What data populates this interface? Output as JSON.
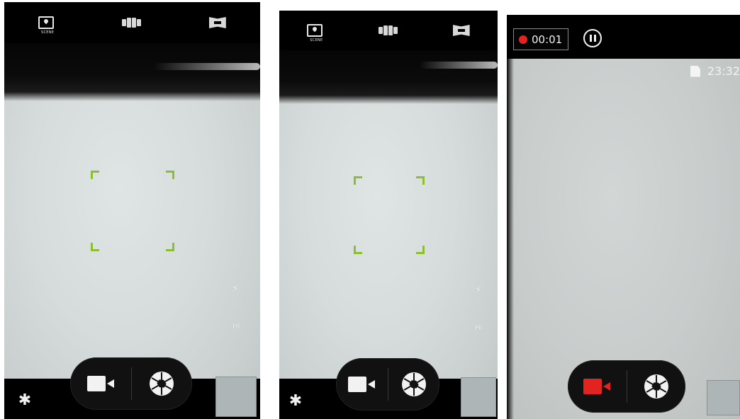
{
  "colors": {
    "focus_bracket": "#8cbf2f",
    "record_red": "#e3231f",
    "panel_black": "#000000"
  },
  "screens": [
    {
      "state": "photo",
      "mode_bar": {
        "scene_label": "SCENE",
        "scene_icon": "scene-icon",
        "multi_icon": "multi-shot-icon",
        "panorama_icon": "panorama-icon"
      },
      "controls": {
        "video_icon": "video-camera-icon",
        "shutter_icon": "shutter-icon",
        "settings_icon": "gear-icon",
        "settings_glyph": "✱",
        "flash_glyph": "⚡",
        "side_glyph": "HI"
      }
    },
    {
      "state": "photo",
      "mode_bar": {
        "scene_label": "SCENE",
        "scene_icon": "scene-icon",
        "multi_icon": "multi-shot-icon",
        "panorama_icon": "panorama-icon"
      },
      "controls": {
        "video_icon": "video-camera-icon",
        "shutter_icon": "shutter-icon",
        "settings_icon": "gear-icon",
        "settings_glyph": "✱",
        "flash_glyph": "⚡",
        "side_glyph": "HI"
      }
    },
    {
      "state": "recording",
      "recording": {
        "elapsed": "00:01",
        "pause_icon": "pause-icon",
        "clock": "23:32",
        "storage_icon": "sd-card-icon"
      },
      "controls": {
        "video_icon": "video-camera-icon",
        "shutter_icon": "shutter-icon"
      }
    }
  ]
}
